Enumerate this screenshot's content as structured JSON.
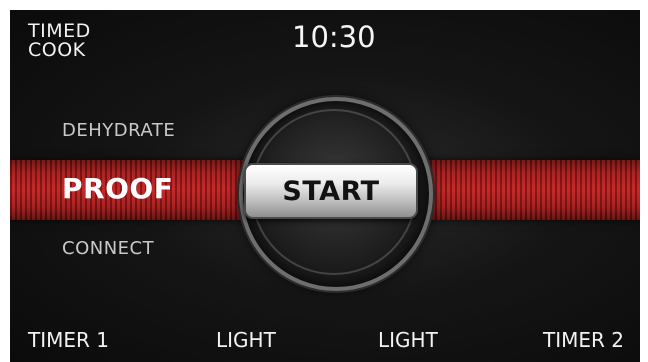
{
  "header": {
    "mode_line1": "TIMED",
    "mode_line2": "COOK",
    "time": "10:30"
  },
  "menu": {
    "items": [
      {
        "label": "DEHYDRATE",
        "selected": false
      },
      {
        "label": "PROOF",
        "selected": true
      },
      {
        "label": "CONNECT",
        "selected": false
      }
    ]
  },
  "dial": {
    "start_label": "START"
  },
  "bottom_bar": {
    "timer1": "TIMER 1",
    "light_left": "LIGHT",
    "light_right": "LIGHT",
    "timer2": "TIMER 2"
  },
  "colors": {
    "background": "#111111",
    "band_red": "#c21f1f",
    "text": "#f2f2f2",
    "button": "#e6e6e6"
  }
}
